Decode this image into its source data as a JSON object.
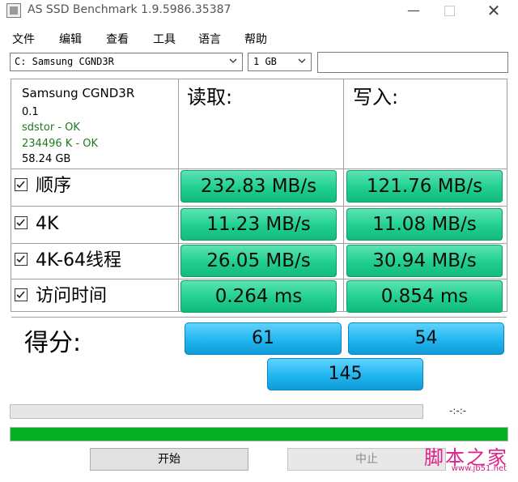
{
  "window": {
    "title": "AS SSD Benchmark 1.9.5986.35387",
    "minimize": "—",
    "close": "✕"
  },
  "menu": [
    "文件",
    "编辑",
    "查看",
    "工具",
    "语言",
    "帮助"
  ],
  "drive_select": {
    "value": "C: Samsung CGND3R"
  },
  "size_select": {
    "value": "1 GB"
  },
  "extra_input": {
    "value": ""
  },
  "drive_info": {
    "name": "Samsung CGND3R",
    "version": "0.1",
    "driver": "sdstor - OK",
    "alignment": "234496 K - OK",
    "capacity": "58.24 GB"
  },
  "headers": {
    "read": "读取:",
    "write": "写入:"
  },
  "tests": [
    {
      "label": "顺序",
      "checked": true,
      "read": "232.83 MB/s",
      "write": "121.76 MB/s"
    },
    {
      "label": "4K",
      "checked": true,
      "read": "11.23 MB/s",
      "write": "11.08 MB/s"
    },
    {
      "label": "4K-64线程",
      "checked": true,
      "read": "26.05 MB/s",
      "write": "30.94 MB/s"
    },
    {
      "label": "访问时间",
      "checked": true,
      "read": "0.264 ms",
      "write": "0.854 ms"
    }
  ],
  "score": {
    "label": "得分:",
    "read": "61",
    "write": "54",
    "total": "145"
  },
  "progress": {
    "elapsed": "-:-:-",
    "fraction": 1.0,
    "fill_color": "#06b025"
  },
  "buttons": {
    "start": "开始",
    "stop": "中止"
  },
  "watermark": {
    "text": "脚本之家",
    "url": "www.jb51.net"
  },
  "colors": {
    "value_green": "#1fcf8f",
    "score_blue": "#20b6f0",
    "info_green": "#1f7a1f"
  }
}
